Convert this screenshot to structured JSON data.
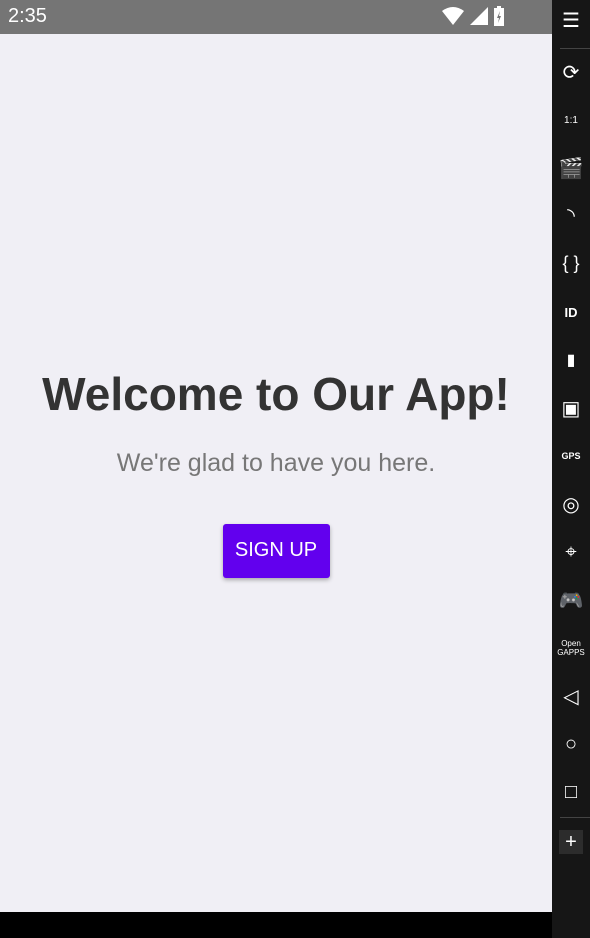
{
  "status_bar": {
    "time": "2:35",
    "icons": [
      "wifi-icon",
      "signal-icon",
      "battery-charging-icon"
    ]
  },
  "main": {
    "title": "Welcome to Our App!",
    "subtitle": "We're glad to have you here.",
    "signup_label": "SIGN UP",
    "accent": "#6200EE"
  },
  "toolbar": {
    "items": [
      "menu",
      "rotate",
      "pixel-perfect",
      "capture",
      "cast",
      "api",
      "identifiers",
      "sim",
      "video",
      "gps",
      "fingerprint",
      "sensors",
      "gamepad",
      "open-gapps",
      "back",
      "home",
      "recent",
      "add"
    ],
    "pixel_label": "1:1",
    "api_label": "{ }",
    "id_label": "ID",
    "gps_label": "GPS",
    "gapps_label": "Open GAPPS",
    "add_label": "+"
  }
}
